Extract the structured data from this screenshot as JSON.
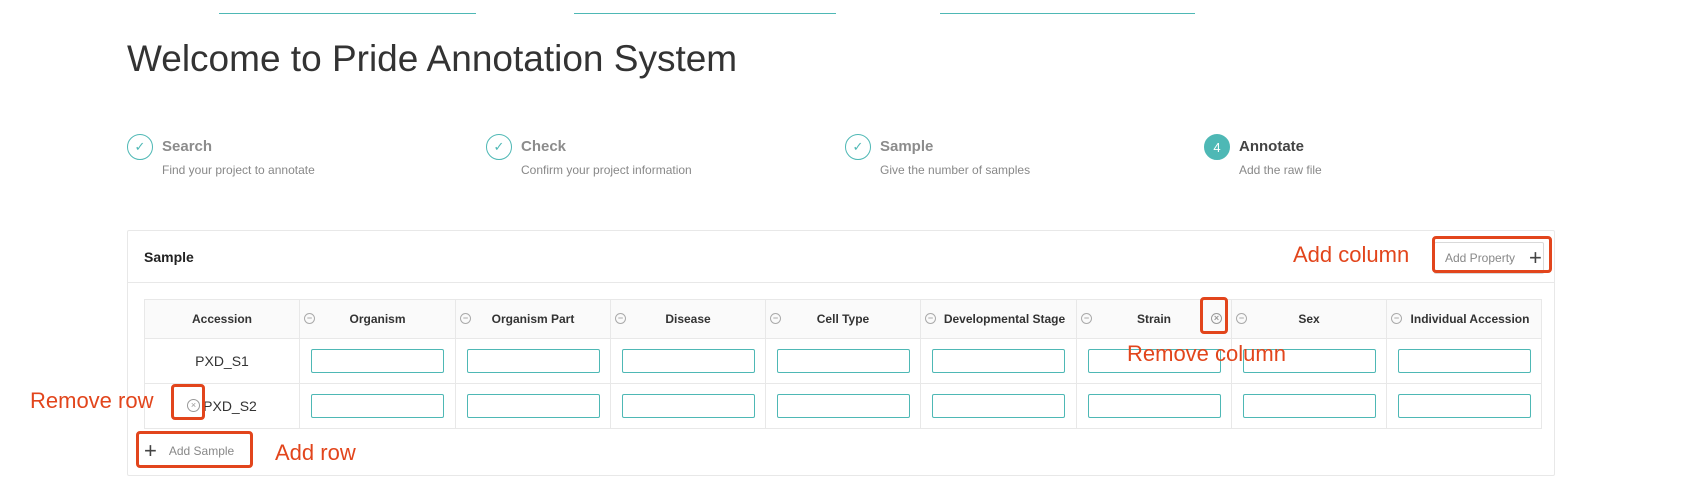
{
  "page": {
    "title": "Welcome to Pride Annotation System"
  },
  "steps": [
    {
      "number": "1",
      "title": "Search",
      "description": "Find your project to annotate",
      "status": "done"
    },
    {
      "number": "2",
      "title": "Check",
      "description": "Confirm your project information",
      "status": "done"
    },
    {
      "number": "3",
      "title": "Sample",
      "description": "Give the number of samples",
      "status": "done"
    },
    {
      "number": "4",
      "title": "Annotate",
      "description": "Add the raw file",
      "status": "active"
    }
  ],
  "card": {
    "title": "Sample",
    "add_property_label": "Add Property",
    "add_sample_label": "Add Sample"
  },
  "table": {
    "columns": [
      "Accession",
      "Organism",
      "Organism Part",
      "Disease",
      "Cell Type",
      "Developmental Stage",
      "Strain",
      "Sex",
      "Individual Accession"
    ],
    "rows": [
      {
        "accession": "PXD_S1"
      },
      {
        "accession": "PXD_S2"
      }
    ]
  },
  "annotations": {
    "add_column": "Add column",
    "remove_column": "Remove column",
    "remove_row": "Remove row",
    "add_row": "Add row"
  },
  "icons": {
    "check": "check-icon",
    "plus": "plus-icon",
    "remove_circle": "close-circle-icon"
  },
  "colors": {
    "accent": "#4eb8b5",
    "annotation": "#e2451c"
  }
}
